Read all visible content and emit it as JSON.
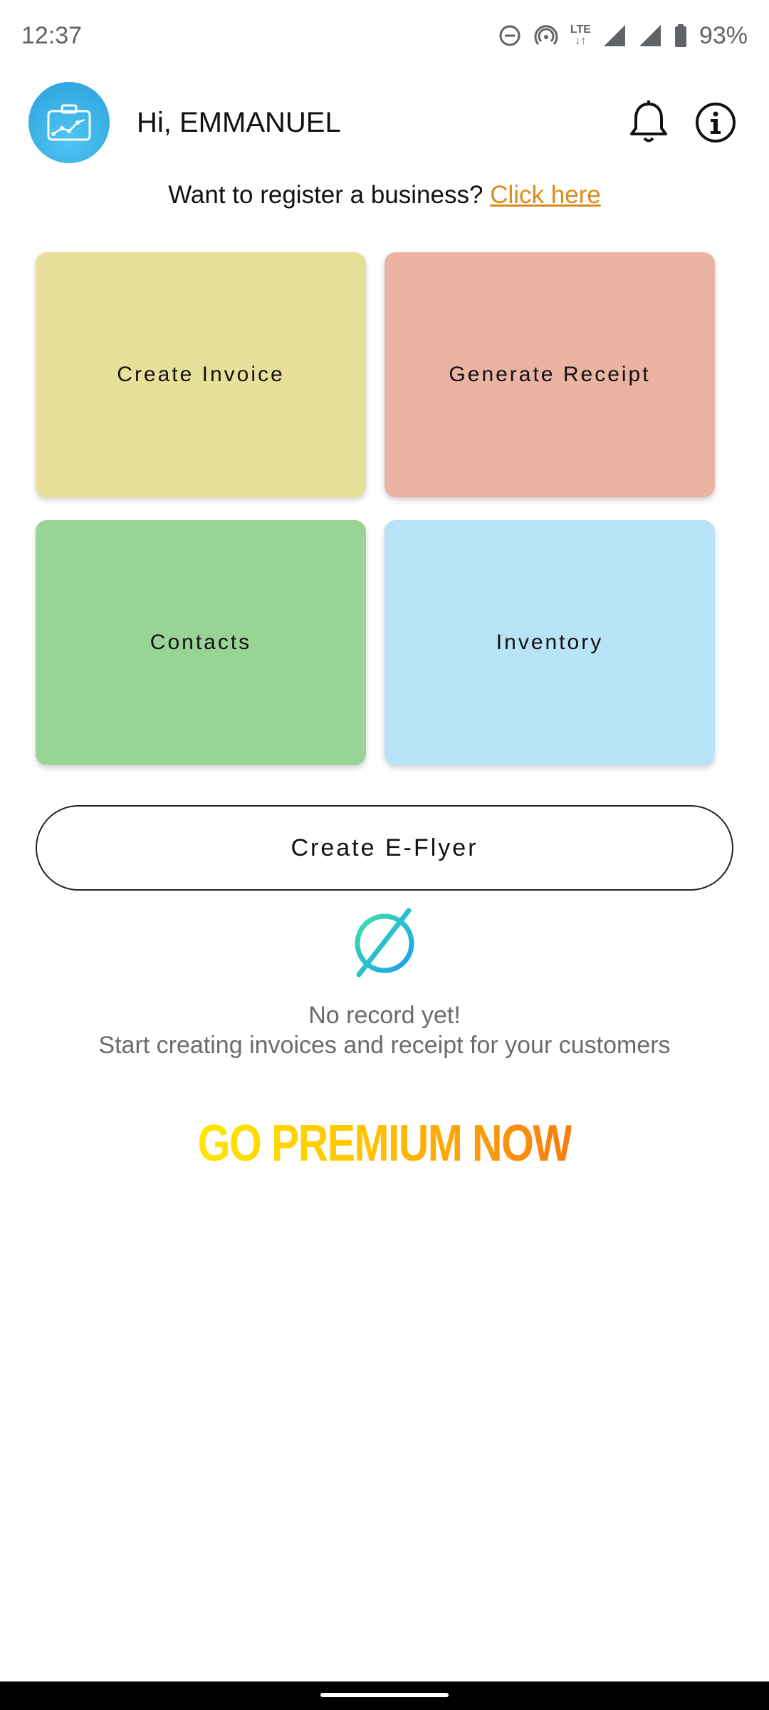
{
  "status_bar": {
    "time": "12:37",
    "network": "LTE",
    "battery": "93%"
  },
  "header": {
    "greeting": "Hi, EMMANUEL",
    "avatar_icon": "briefcase-chart-icon",
    "notification_icon": "bell-icon",
    "info_icon": "info-icon"
  },
  "register": {
    "prompt": "Want to register a business?",
    "link": "Click here"
  },
  "tiles": [
    {
      "label": "Create Invoice",
      "color": "#e7e09b"
    },
    {
      "label": "Generate Receipt",
      "color": "#eab3a2"
    },
    {
      "label": "Contacts",
      "color": "#98d595"
    },
    {
      "label": "Inventory",
      "color": "#b9e3f7"
    }
  ],
  "eflyer_button": "Create E-Flyer",
  "empty_state": {
    "icon": "empty-set-icon",
    "title": "No record yet!",
    "subtitle": "Start creating invoices and receipt for your customers"
  },
  "premium": "GO PREMIUM NOW",
  "colors": {
    "accent_link": "#d98c19",
    "avatar_blue": "#2b9fdc"
  }
}
